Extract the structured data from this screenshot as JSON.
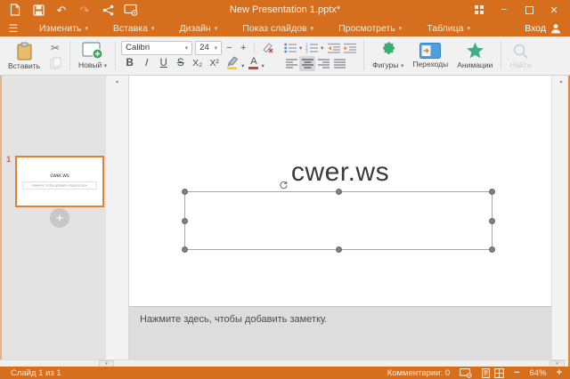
{
  "titlebar": {
    "title": "New Presentation 1.pptx*"
  },
  "menubar": {
    "items": [
      "Изменить",
      "Вставка",
      "Дизайн",
      "Показ слайдов",
      "Просмотреть",
      "Таблица"
    ],
    "login_label": "Вход"
  },
  "toolbar": {
    "paste_label": "Вставить",
    "new_slide_label": "Новый",
    "font_name": "Calibri",
    "font_size": "24",
    "bold": "B",
    "italic": "I",
    "underline": "U",
    "strikethrough": "S",
    "subscript": "X₂",
    "superscript": "X²",
    "shapes_label": "Фигуры",
    "transitions_label": "Переходы",
    "animations_label": "Анимации",
    "find_label": "Найти"
  },
  "slide_panel": {
    "slide_number": "1",
    "thumbnail_title": "cwer.ws",
    "thumbnail_subtitle_placeholder": "Нажмите, чтобы добавить подзаголовок"
  },
  "slide": {
    "title": "cwer.ws"
  },
  "notes": {
    "placeholder": "Нажмите здесь, чтобы добавить заметку."
  },
  "statusbar": {
    "slide_position": "Слайд 1 из 1",
    "comments": "Комментарии: 0",
    "zoom_level": "64%"
  },
  "icons": {
    "hamburger": "☰",
    "dropdown": "▾",
    "scissors": "✂",
    "undo": "↶",
    "redo": "↷",
    "minimize": "−",
    "close": "✕",
    "scroll_up": "▴",
    "scroll_down": "▾",
    "minus": "−",
    "plus": "+",
    "add": "+"
  },
  "colors": {
    "accent_orange": "#D56E1D",
    "thumbnail_border": "#E0812F",
    "shapes_green": "#3BAC72",
    "transitions_blue": "#4D9EDB",
    "animations_teal": "#3FAE85",
    "highlight_yellow": "#F3D11F",
    "font_color_red": "#E03C31",
    "handle_gray": "#7F7F7F"
  }
}
